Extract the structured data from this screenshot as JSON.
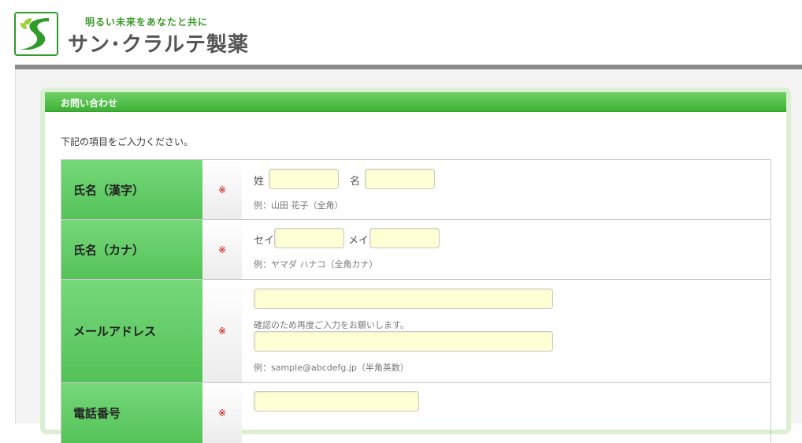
{
  "header": {
    "tagline": "明るい未来をあなたと共に",
    "company": "サン･クラルテ製薬",
    "logo_icon": "s-road-leaf-logo-icon"
  },
  "panel": {
    "title": "お問い合わせ",
    "intro": "下記の項目をご入力ください。"
  },
  "form": {
    "required_mark": "※",
    "name_kanji": {
      "label": "氏名（漢字）",
      "last_prefix": "姓",
      "first_prefix": "名",
      "last_value": "",
      "first_value": "",
      "hint": "例：山田 花子（全角）"
    },
    "name_kana": {
      "label": "氏名（カナ）",
      "last_prefix": "セイ",
      "first_prefix": "メイ",
      "last_value": "",
      "first_value": "",
      "hint": "例：ヤマダ ハナコ（全角カナ）"
    },
    "email": {
      "label": "メールアドレス",
      "value": "",
      "confirm_note": "確認のため再度ご入力をお願いします。",
      "confirm_value": "",
      "hint": "例：sample@abcdefg.jp（半角英数）"
    },
    "phone": {
      "label": "電話番号",
      "value": ""
    }
  },
  "colors": {
    "accent_green": "#3eb135",
    "label_green": "#6dd571",
    "input_bg": "#ffffd6",
    "required_red": "#cc0000"
  }
}
